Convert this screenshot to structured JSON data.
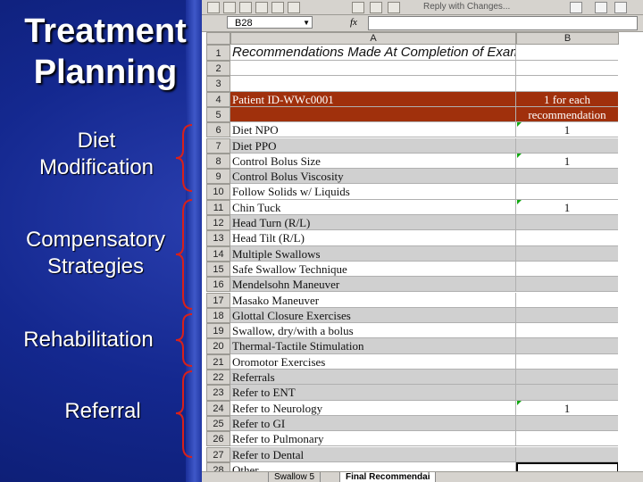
{
  "slide": {
    "title_line1": "Treatment",
    "title_line2": "Planning",
    "categories": [
      {
        "line1": "Diet",
        "line2": "Modification"
      },
      {
        "line1": "Compensatory",
        "line2": "Strategies"
      },
      {
        "line1": "Rehabilitation",
        "line2": ""
      },
      {
        "line1": "Referral",
        "line2": ""
      }
    ]
  },
  "toolbar": {
    "reply_label": "Reply with Changes..."
  },
  "formula_bar": {
    "cell_ref": "B28",
    "fx_label": "fx"
  },
  "columns": [
    "A",
    "B"
  ],
  "rows": [
    {
      "num": "1",
      "a": "Recommendations Made At Completion of Exam",
      "b": ""
    },
    {
      "num": "2",
      "a": "",
      "b": ""
    },
    {
      "num": "3",
      "a": "",
      "b": ""
    },
    {
      "num": "4",
      "a": "Patient ID-WWc0001",
      "b": "1 for each"
    },
    {
      "num": "5",
      "a": "",
      "b": "recommendation"
    },
    {
      "num": "6",
      "a": "Diet NPO",
      "b": "1"
    },
    {
      "num": "7",
      "a": "Diet PPO",
      "b": ""
    },
    {
      "num": "8",
      "a": "Control Bolus Size",
      "b": "1"
    },
    {
      "num": "9",
      "a": "Control Bolus Viscosity",
      "b": ""
    },
    {
      "num": "10",
      "a": "Follow Solids w/ Liquids",
      "b": ""
    },
    {
      "num": "11",
      "a": "Chin Tuck",
      "b": "1"
    },
    {
      "num": "12",
      "a": "Head Turn (R/L)",
      "b": ""
    },
    {
      "num": "13",
      "a": "Head Tilt (R/L)",
      "b": ""
    },
    {
      "num": "14",
      "a": "Multiple Swallows",
      "b": ""
    },
    {
      "num": "15",
      "a": "Safe Swallow Technique",
      "b": ""
    },
    {
      "num": "16",
      "a": "Mendelsohn Maneuver",
      "b": ""
    },
    {
      "num": "17",
      "a": "Masako Maneuver",
      "b": ""
    },
    {
      "num": "18",
      "a": "Glottal Closure Exercises",
      "b": ""
    },
    {
      "num": "19",
      "a": "Swallow, dry/with a bolus",
      "b": ""
    },
    {
      "num": "20",
      "a": "Thermal-Tactile Stimulation",
      "b": ""
    },
    {
      "num": "21",
      "a": "Oromotor Exercises",
      "b": ""
    },
    {
      "num": "22",
      "a": "Referrals",
      "b": ""
    },
    {
      "num": "23",
      "a": "Refer to ENT",
      "b": ""
    },
    {
      "num": "24",
      "a": "Refer to Neurology",
      "b": "1"
    },
    {
      "num": "25",
      "a": "Refer to GI",
      "b": ""
    },
    {
      "num": "26",
      "a": "Refer to Pulmonary",
      "b": ""
    },
    {
      "num": "27",
      "a": "Refer to Dental",
      "b": ""
    },
    {
      "num": "28",
      "a": "Other",
      "b": ""
    }
  ],
  "sheet_tabs": [
    "Swallow 5",
    "Final Recommendai"
  ],
  "colors": {
    "header_red": "#a0300c",
    "shade_grey": "#d0d0d0",
    "comment_marker": "#11a811",
    "slide_blue": "#14288f"
  }
}
